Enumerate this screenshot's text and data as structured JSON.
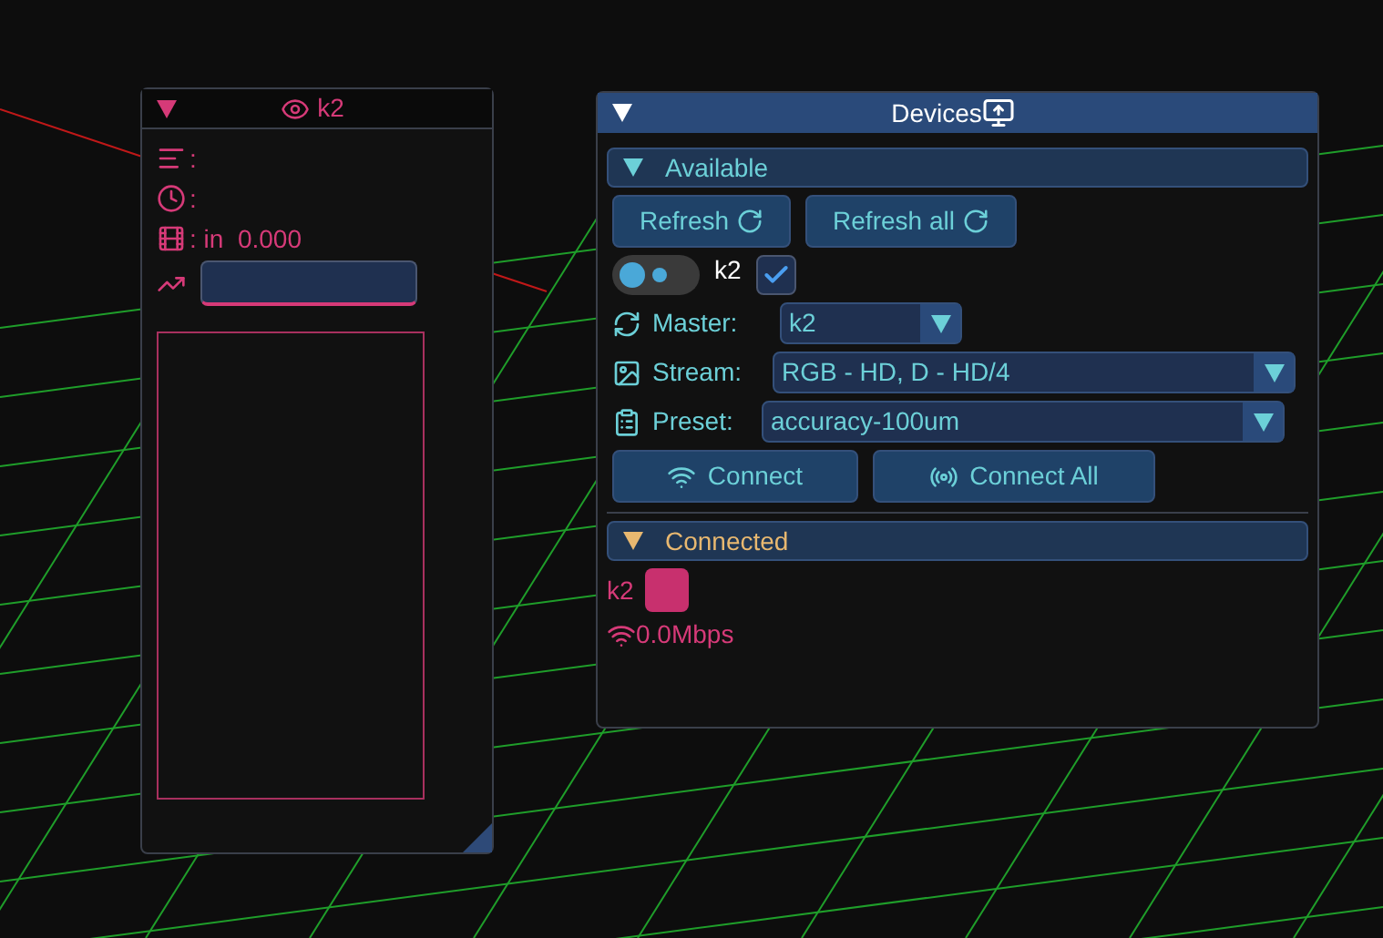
{
  "stream_window": {
    "title": "k2",
    "expanded": true,
    "rows": [
      {
        "kind": "sort",
        "text": ":"
      },
      {
        "kind": "clock",
        "text": ":"
      },
      {
        "kind": "film",
        "text": ": in  0.000"
      }
    ]
  },
  "devices_window": {
    "title": "Devices",
    "expanded": true,
    "available": {
      "label": "Available",
      "expanded": true,
      "refresh_buttons": [
        "Refresh",
        "Refresh all"
      ],
      "device": {
        "name": "k2",
        "on": false,
        "checked": true
      },
      "fields": [
        {
          "kind": "sync",
          "label": "Master:",
          "value": "k2"
        },
        {
          "kind": "image",
          "label": "Stream:",
          "value": "RGB - HD, D - HD/4"
        },
        {
          "kind": "clipboard",
          "label": "Preset:",
          "value": "accuracy-100um"
        }
      ],
      "connect_buttons": [
        {
          "kind": "wifi",
          "label": "Connect"
        },
        {
          "kind": "broadcast",
          "label": "Connect All"
        }
      ]
    },
    "connected": {
      "label": "Connected",
      "expanded": true,
      "devices": [
        {
          "name": "k2",
          "color": "#c8306e",
          "rate": "0.0Mbps"
        }
      ]
    }
  }
}
